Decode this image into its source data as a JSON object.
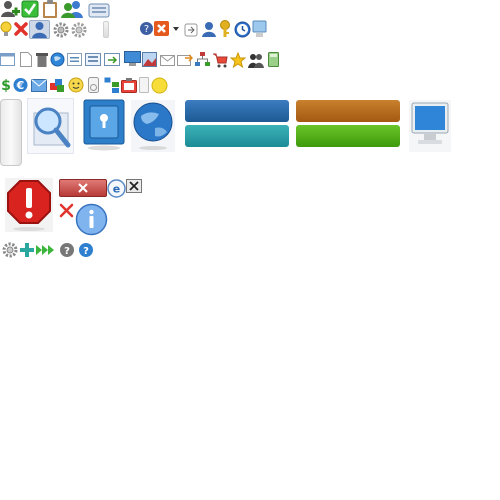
{
  "sprite_sheet": {
    "icons": [
      "user-add-icon",
      "checkbox-checked-icon",
      "clipboard-icon",
      "users-icon",
      "keyboard-icon",
      "lightbulb-icon",
      "delete-x-icon",
      "user-selected-icon",
      "gear-icon",
      "gears-icon",
      "help-icon",
      "close-dropdown-icon",
      "forward-icon",
      "user-icon",
      "key-icon",
      "clock-icon",
      "monitor-small-icon",
      "window-icon",
      "document-icon",
      "trash-icon",
      "globe-small-icon",
      "window-list-icon",
      "form-icon",
      "window-arrow-icon",
      "monitor-icon",
      "picture-icon",
      "envelope-icon",
      "mail-forward-icon",
      "sitemap-icon",
      "cart-icon",
      "star-icon",
      "users-dark-icon",
      "calculator-icon",
      "dollar-icon",
      "euro-icon",
      "mail-folder-icon",
      "applications-icon",
      "smiley-icon",
      "ipod-icon",
      "folder-tree-icon",
      "notepad-icon",
      "toolbox-icon",
      "yellow-dot-icon",
      "search-large-icon",
      "safe-large-icon",
      "globe-large-icon",
      "computer-large-icon",
      "error-stop-large-icon",
      "small-x-icon",
      "info-large-icon",
      "gear-small-icon",
      "plus-icon",
      "fast-forward-icon",
      "help-gray-icon",
      "help-blue-icon"
    ],
    "colors": {
      "blue_tab": "#1d5a94",
      "teal_tab": "#1c8c96",
      "orange_tab": "#a45a10",
      "green_tab": "#3e9a0a",
      "close_red": "#c9403c",
      "error_red": "#d8231f",
      "info_blue": "#5a9be0"
    }
  }
}
